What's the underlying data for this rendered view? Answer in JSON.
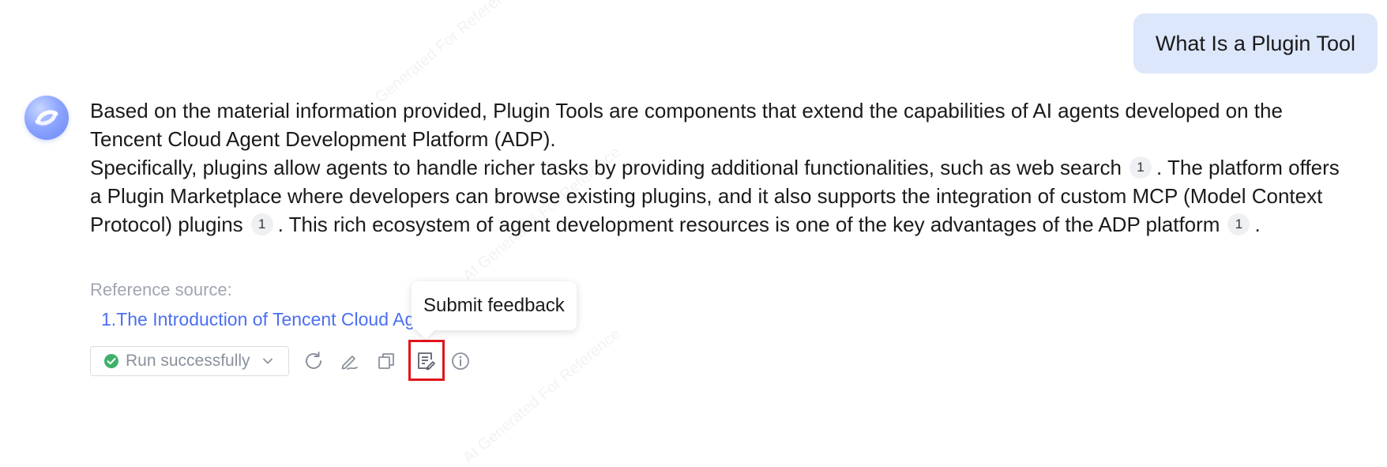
{
  "user_message": "What Is a Plugin Tool",
  "answer": {
    "p1": "Based on the material information provided, Plugin Tools are components that extend the capabilities of AI agents developed on the Tencent Cloud Agent Development Platform (ADP).",
    "p2_a": "Specifically, plugins allow agents to handle richer tasks by providing additional functionalities, such as web search",
    "p2_b": ". The platform offers a Plugin Marketplace where developers can browse existing plugins, and it also supports the integration of custom MCP (Model Context Protocol) plugins",
    "p2_c": ". This rich ecosystem of agent development resources is one of the key advantages of the ADP platform",
    "p2_d": ".",
    "citation": "1"
  },
  "reference": {
    "label": "Reference source:",
    "link_text": "1.The Introduction of Tencent Cloud Agent Development Platform"
  },
  "status": {
    "label": "Run successfully",
    "color": "#3fb06b"
  },
  "tooltip": "Submit feedback",
  "watermark": "AI Generated For Reference",
  "icons": [
    "refresh-icon",
    "edit-icon",
    "copy-icon",
    "feedback-icon",
    "info-icon"
  ],
  "colors": {
    "accent": "#4b6ff0",
    "bubble": "#dde7fb",
    "highlight": "#e0161b"
  }
}
